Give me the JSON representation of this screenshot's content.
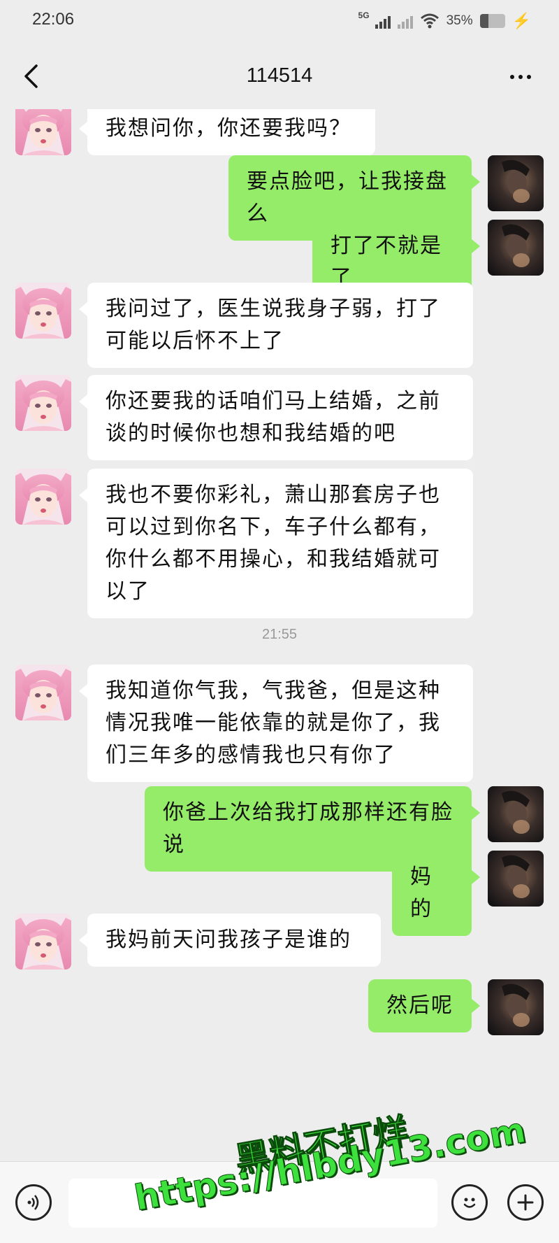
{
  "status_bar": {
    "time": "22:06",
    "network": "5G",
    "battery": "35%",
    "battery_level": 0.35
  },
  "header": {
    "title": "114514"
  },
  "messages": [
    {
      "side": "in",
      "text": "我想问你，你还要我吗？"
    },
    {
      "side": "out",
      "text": "要点脸吧，让我接盘么"
    },
    {
      "side": "out",
      "text": "打了不就是了"
    },
    {
      "side": "in",
      "text": "我问过了，医生说我身子弱，打了可能以后怀不上了"
    },
    {
      "side": "in",
      "text": "你还要我的话咱们马上结婚，之前谈的时候你也想和我结婚的吧"
    },
    {
      "side": "in",
      "text": "我也不要你彩礼，萧山那套房子也可以过到你名下，车子什么都有，你什么都不用操心，和我结婚就可以了"
    },
    {
      "side": "in",
      "text": "我知道你气我，气我爸，但是这种情况我唯一能依靠的就是你了，我们三年多的感情我也只有你了"
    },
    {
      "side": "out",
      "text": "你爸上次给我打成那样还有脸说"
    },
    {
      "side": "out",
      "text": "妈的"
    },
    {
      "side": "in",
      "text": "我妈前天问我孩子是谁的"
    },
    {
      "side": "out",
      "text": "然后呢"
    }
  ],
  "timestamp": "21:55",
  "input": {
    "placeholder": ""
  },
  "watermark": {
    "line1": "黑料不打烊",
    "line2": "https://hlbdy13.com"
  },
  "colors": {
    "background": "#ededed",
    "bubble_out": "#95ec69",
    "bubble_in": "#ffffff"
  }
}
